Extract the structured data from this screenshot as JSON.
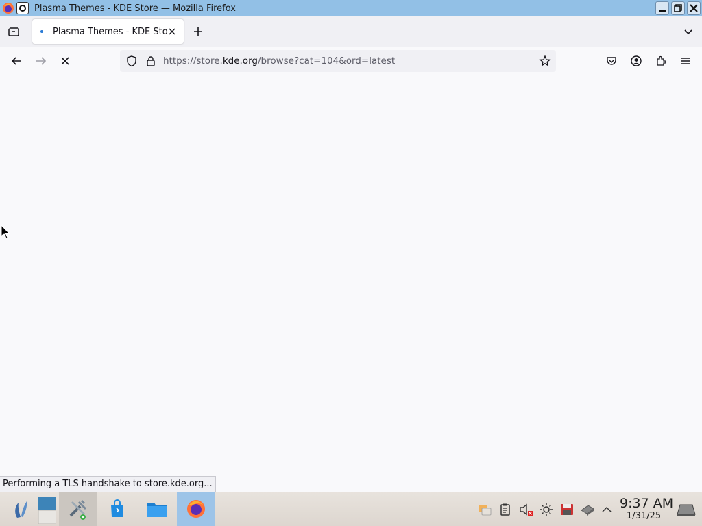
{
  "window": {
    "title": "Plasma Themes - KDE Store — Mozilla Firefox"
  },
  "tabs": [
    {
      "label": "Plasma Themes - KDE Store",
      "loading": true
    }
  ],
  "navbar": {
    "url_prefix": "https://store.",
    "url_host": "kde.org",
    "url_path": "/browse?cat=104&ord=latest"
  },
  "status": {
    "text": "Performing a TLS handshake to store.kde.org..."
  },
  "taskbar": {
    "items": [
      "application-launcher-icon",
      "desktop-pager-icon",
      "system-settings-icon",
      "discover-store-icon",
      "file-manager-icon",
      "firefox-icon"
    ],
    "active_item": "firefox-icon"
  },
  "tray": {
    "icons": [
      "chat-icon",
      "clipboard-icon",
      "volume-muted-icon",
      "brightness-icon",
      "disk-icon",
      "network-icon",
      "expand-tray-icon"
    ]
  },
  "clock": {
    "time": "9:37 AM",
    "date": "1/31/25"
  },
  "colors": {
    "titlebar": "#92c0e6",
    "taskbar_active": "#9dc4e8",
    "page_bg": "#f9f9fb"
  }
}
